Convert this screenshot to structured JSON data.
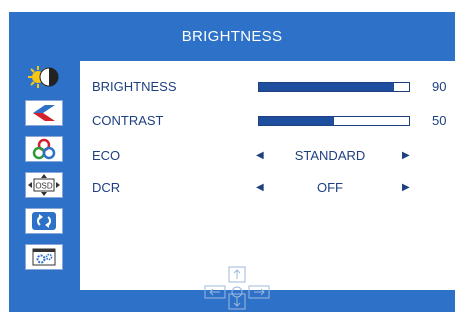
{
  "header": {
    "title": "BRIGHTNESS"
  },
  "sidebar": {
    "items": [
      {
        "icon": "sun-moon-icon",
        "selected": true
      },
      {
        "icon": "image-color-icon",
        "selected": false
      },
      {
        "icon": "color-wheel-icon",
        "selected": false
      },
      {
        "icon": "osd-icon",
        "label": "OSD",
        "selected": false
      },
      {
        "icon": "reset-icon",
        "selected": false
      },
      {
        "icon": "settings-icon",
        "selected": false
      }
    ]
  },
  "settings": {
    "brightness": {
      "label": "BRIGHTNESS",
      "value": "90",
      "level": 0.9
    },
    "contrast": {
      "label": "CONTRAST",
      "value": "50",
      "level": 0.5
    },
    "eco": {
      "label": "ECO",
      "value": "STANDARD"
    },
    "dcr": {
      "label": "DCR",
      "value": "OFF"
    }
  },
  "colors": {
    "accent": "#2d72c8",
    "text": "#1e3f80",
    "bar_fill": "#1e4f9e"
  }
}
